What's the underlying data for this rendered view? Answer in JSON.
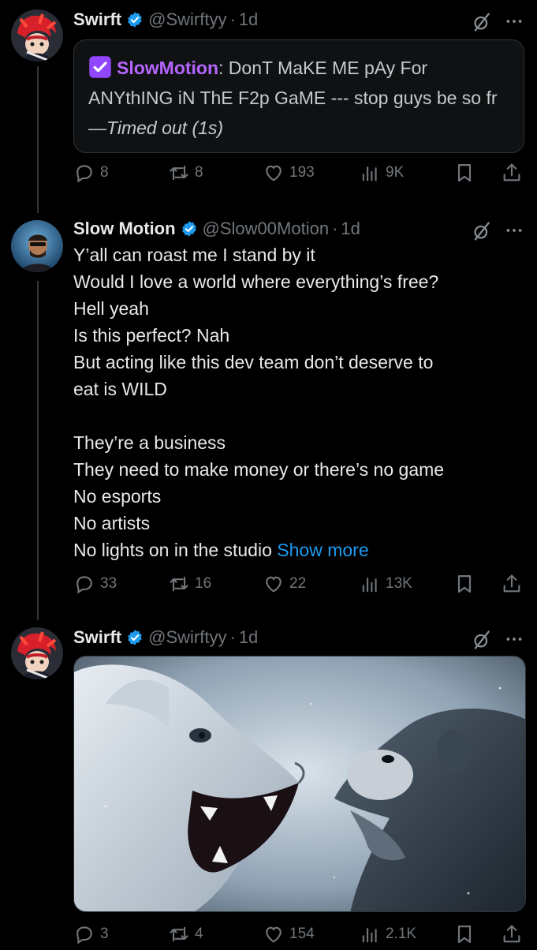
{
  "tweets": [
    {
      "name": "Swirft",
      "handle": "@Swirftyy",
      "time": "1d",
      "quote": {
        "user": "SlowMotion",
        "separator": ":",
        "text": " DonT MaKE ME pAy For ANYthING iN ThE F2p GaME --- stop guys be so fr—",
        "suffix": "Timed out (1s)"
      },
      "stats": {
        "replies": "8",
        "reposts": "8",
        "likes": "193",
        "views": "9K"
      }
    },
    {
      "name": "Slow Motion",
      "handle": "@Slow00Motion",
      "time": "1d",
      "body": "Y’all can roast me I stand by it\nWould I love a world where everything’s free?\nHell yeah\nIs this perfect? Nah\nBut acting like this dev team don’t deserve to\neat is WILD\n\nThey’re a business\nThey need to make money or there’s no game\nNo esports\nNo artists\nNo lights on in the studio ",
      "show_more": "Show more",
      "stats": {
        "replies": "33",
        "reposts": "16",
        "likes": "22",
        "views": "13K"
      }
    },
    {
      "name": "Swirft",
      "handle": "@Swirftyy",
      "time": "1d",
      "stats": {
        "replies": "3",
        "reposts": "4",
        "likes": "154",
        "views": "2.1K"
      }
    }
  ],
  "separator_dot": "·",
  "colors": {
    "background": "#000000",
    "text": "#e7e9ea",
    "muted": "#71767b",
    "link": "#1d9bf0",
    "verified": "#1d9bf0",
    "quote_user": "#b565ff"
  },
  "icons": [
    "verified-badge-icon",
    "grok-icon",
    "more-icon",
    "reply-icon",
    "repost-icon",
    "like-icon",
    "views-icon",
    "bookmark-icon",
    "share-icon"
  ]
}
